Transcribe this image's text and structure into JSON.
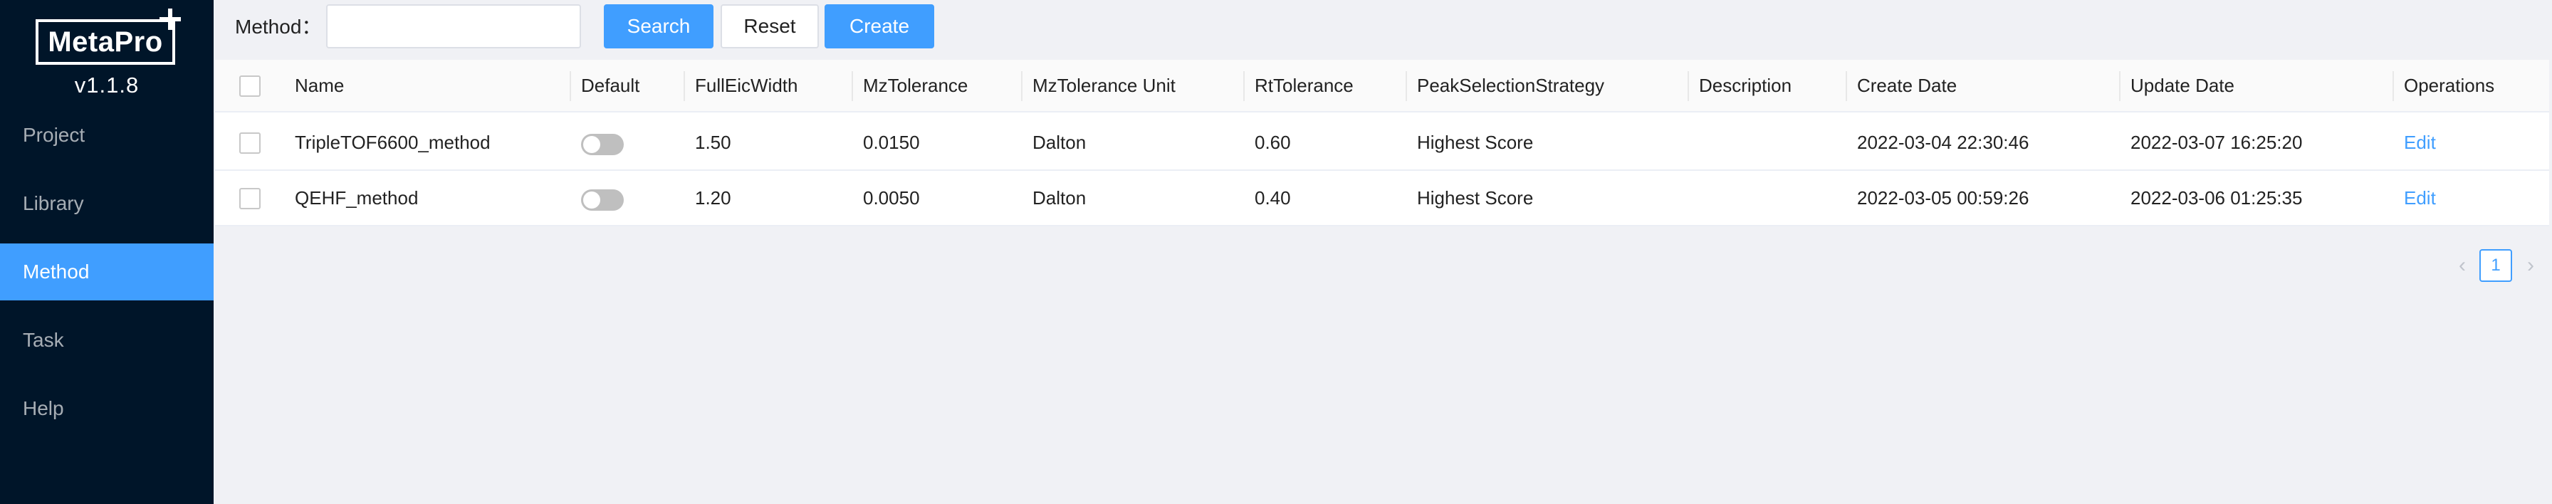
{
  "app": {
    "logo_text": "MetaPro",
    "version": "v1.1.8"
  },
  "sidebar": {
    "items": [
      {
        "label": "Project",
        "active": false
      },
      {
        "label": "Library",
        "active": false
      },
      {
        "label": "Method",
        "active": true
      },
      {
        "label": "Task",
        "active": false
      },
      {
        "label": "Help",
        "active": false
      }
    ]
  },
  "toolbar": {
    "method_label": "Method：",
    "search_value": "",
    "search_placeholder": "",
    "search_button": "Search",
    "reset_button": "Reset",
    "create_button": "Create"
  },
  "table": {
    "columns": [
      "Name",
      "Default",
      "FullEicWidth",
      "MzTolerance",
      "MzTolerance Unit",
      "RtTolerance",
      "PeakSelectionStrategy",
      "Description",
      "Create Date",
      "Update Date",
      "Operations"
    ],
    "rows": [
      {
        "name": "TripleTOF6600_method",
        "default": false,
        "full_eic_width": "1.50",
        "mz_tolerance": "0.0150",
        "mz_tolerance_unit": "Dalton",
        "rt_tolerance": "0.60",
        "peak_selection_strategy": "Highest Score",
        "description": "",
        "create_date": "2022-03-04 22:30:46",
        "update_date": "2022-03-07 16:25:20",
        "operation": "Edit"
      },
      {
        "name": "QEHF_method",
        "default": false,
        "full_eic_width": "1.20",
        "mz_tolerance": "0.0050",
        "mz_tolerance_unit": "Dalton",
        "rt_tolerance": "0.40",
        "peak_selection_strategy": "Highest Score",
        "description": "",
        "create_date": "2022-03-05 00:59:26",
        "update_date": "2022-03-06 01:25:35",
        "operation": "Edit"
      }
    ]
  },
  "pagination": {
    "current_page": "1",
    "prev_icon": "‹",
    "next_icon": "›"
  },
  "colors": {
    "sidebar_bg": "#001529",
    "accent": "#409eff",
    "page_bg": "#f0f1f5"
  }
}
